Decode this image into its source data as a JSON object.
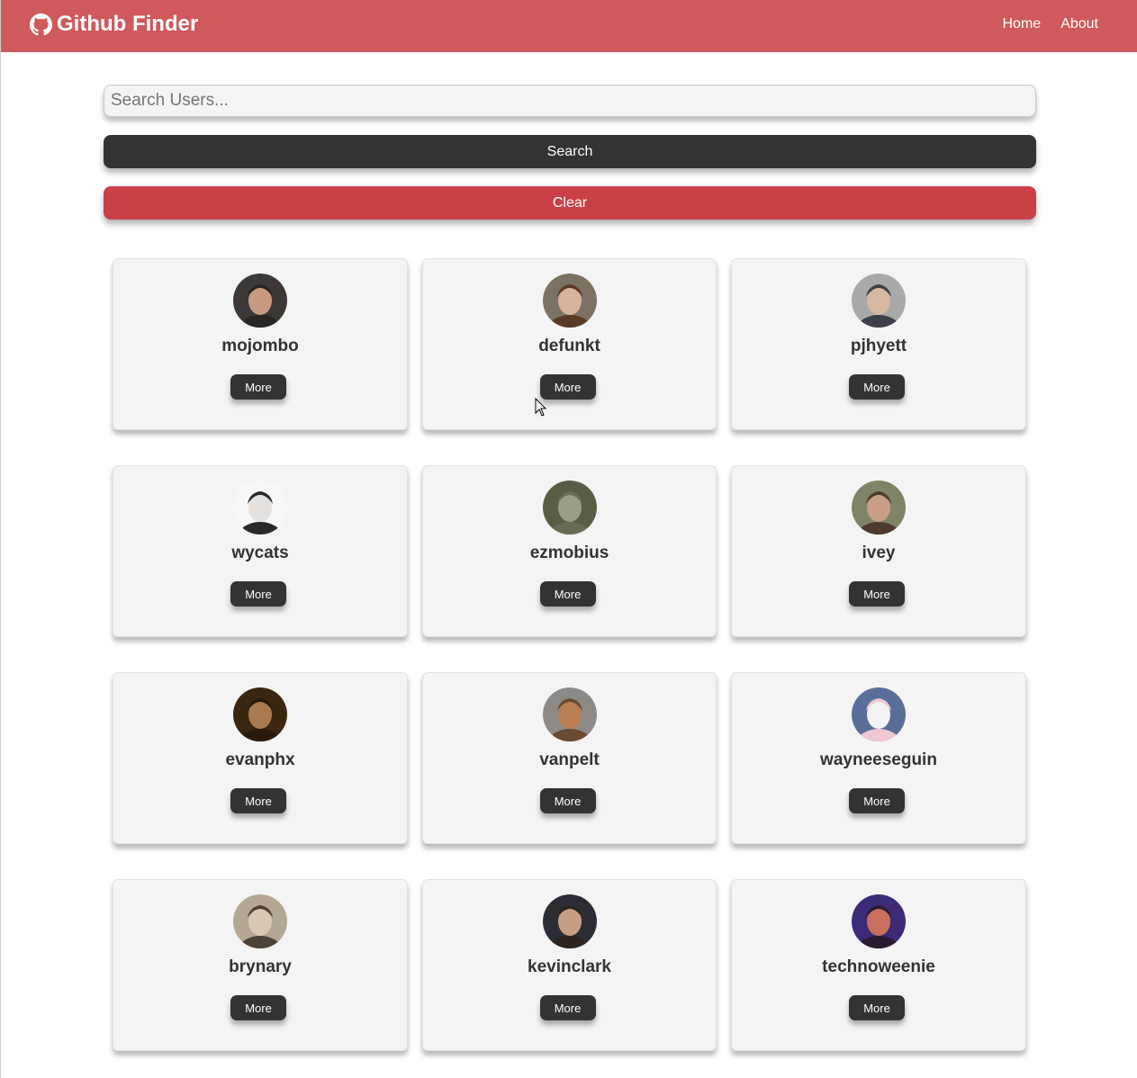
{
  "navbar": {
    "brand": "Github Finder",
    "links": [
      {
        "label": "Home"
      },
      {
        "label": "About"
      }
    ]
  },
  "search": {
    "placeholder": "Search Users...",
    "value": "",
    "search_label": "Search",
    "clear_label": "Clear"
  },
  "users": [
    {
      "login": "mojombo",
      "more_label": "More",
      "skin": "#c79a82",
      "hair": "#2a2422",
      "bg": "#3d3835"
    },
    {
      "login": "defunkt",
      "more_label": "More",
      "skin": "#d8b39c",
      "hair": "#5a3a24",
      "bg": "#7c7264"
    },
    {
      "login": "pjhyett",
      "more_label": "More",
      "skin": "#d6b7a2",
      "hair": "#3c4048",
      "bg": "#a9a9a9"
    },
    {
      "login": "wycats",
      "more_label": "More",
      "skin": "#e6e1dc",
      "hair": "#2a2a2a",
      "bg": "#f7f7f7"
    },
    {
      "login": "ezmobius",
      "more_label": "More",
      "skin": "#9d9c84",
      "hair": "#6b6a54",
      "bg": "#5c5b46"
    },
    {
      "login": "ivey",
      "more_label": "More",
      "skin": "#c89e84",
      "hair": "#4e3a2c",
      "bg": "#7f8466"
    },
    {
      "login": "evanphx",
      "more_label": "More",
      "skin": "#a87a52",
      "hair": "#2a1a0c",
      "bg": "#3b2710"
    },
    {
      "login": "vanpelt",
      "more_label": "More",
      "skin": "#b97e52",
      "hair": "#6a4a30",
      "bg": "#8d8a86"
    },
    {
      "login": "wayneeseguin",
      "more_label": "More",
      "skin": "#f3f3f3",
      "hair": "#f0c8d0",
      "bg": "#5a6e9a"
    },
    {
      "login": "brynary",
      "more_label": "More",
      "skin": "#d9c8b4",
      "hair": "#4e4238",
      "bg": "#b4a894"
    },
    {
      "login": "kevinclark",
      "more_label": "More",
      "skin": "#c79e84",
      "hair": "#2c241e",
      "bg": "#2a2e34"
    },
    {
      "login": "technoweenie",
      "more_label": "More",
      "skin": "#c9705c",
      "hair": "#2a1c2e",
      "bg": "#3d2a78"
    }
  ]
}
